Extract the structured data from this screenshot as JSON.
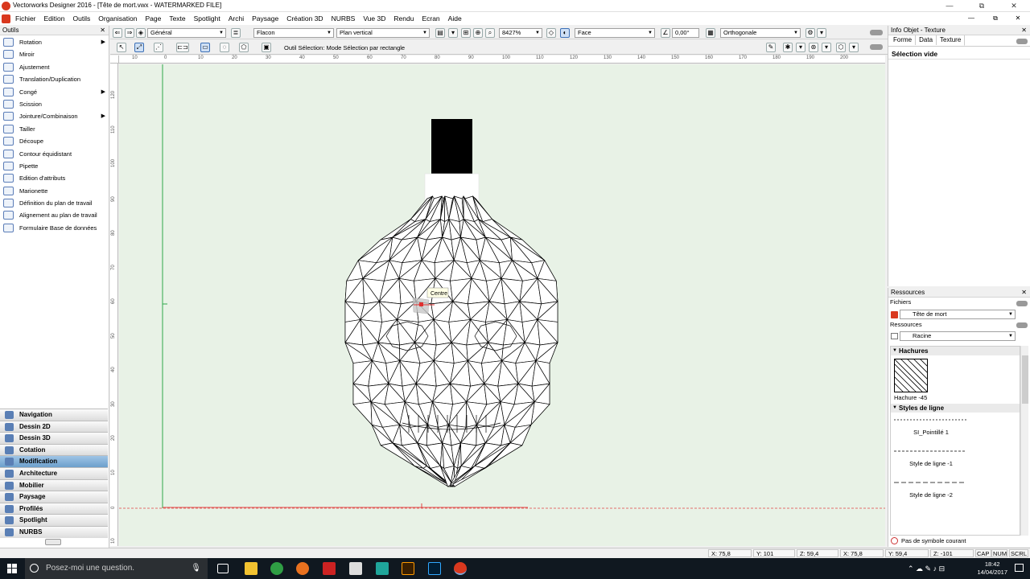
{
  "window": {
    "title": "Vectorworks Designer 2016 - [Tête de mort.vwx - WATERMARKED FILE]",
    "controls": [
      "—",
      "⧉",
      "✕"
    ],
    "doc_controls": [
      "—",
      "⧉",
      "✕"
    ]
  },
  "menu": [
    "Fichier",
    "Edition",
    "Outils",
    "Organisation",
    "Page",
    "Texte",
    "Spotlight",
    "Archi",
    "Paysage",
    "Création 3D",
    "NURBS",
    "Vue 3D",
    "Rendu",
    "Ecran",
    "Aide"
  ],
  "tools": {
    "title": "Outils",
    "items": [
      {
        "label": "Rotation",
        "arrow": true
      },
      {
        "label": "Miroir",
        "arrow": false
      },
      {
        "label": "Ajustement",
        "arrow": false
      },
      {
        "label": "Translation/Duplication",
        "arrow": false
      },
      {
        "label": "Congé",
        "arrow": true
      },
      {
        "label": "Scission",
        "arrow": false
      },
      {
        "label": "Jointure/Combinaison",
        "arrow": true
      },
      {
        "label": "Tailler",
        "arrow": false
      },
      {
        "label": "Découpe",
        "arrow": false
      },
      {
        "label": "Contour équidistant",
        "arrow": false
      },
      {
        "label": "Pipette",
        "arrow": false
      },
      {
        "label": "Edition d'attributs",
        "arrow": false
      },
      {
        "label": "Marionette",
        "arrow": false
      },
      {
        "label": "Définition du plan de travail",
        "arrow": false
      },
      {
        "label": "Alignement au plan de travail",
        "arrow": false
      },
      {
        "label": "Formulaire Base de données",
        "arrow": false
      }
    ],
    "palettes": [
      "Navigation",
      "Dessin 2D",
      "Dessin 3D",
      "Cotation",
      "Modification",
      "Architecture",
      "Mobilier",
      "Paysage",
      "Profilés",
      "Spotlight",
      "NURBS"
    ],
    "selected_palette": "Modification"
  },
  "toolbar": {
    "class_value": "Général",
    "layer_value": "Flacon",
    "plane_value": "Plan vertical",
    "zoom_value": "8427%",
    "view_value": "Face",
    "angle_value": "0,00°",
    "projection_value": "Orthogonale",
    "mode_text": "Outil Sélection: Mode Sélection par rectangle"
  },
  "rulers": {
    "h": [
      "10",
      "0",
      "10",
      "20",
      "30",
      "40",
      "50",
      "60",
      "70",
      "80",
      "90",
      "100",
      "110",
      "120",
      "130",
      "140",
      "150",
      "160",
      "170",
      "180",
      "190",
      "200"
    ],
    "v": [
      "120",
      "110",
      "100",
      "90",
      "80",
      "70",
      "60",
      "50",
      "40",
      "30",
      "20",
      "10",
      "0",
      "10"
    ]
  },
  "canvas": {
    "snap_tooltip": "Centre"
  },
  "obj_info": {
    "title": "Info Objet - Texture",
    "tabs": [
      "Forme",
      "Data",
      "Texture"
    ],
    "active_tab": "Texture",
    "status": "Sélection vide"
  },
  "resources": {
    "title": "Ressources",
    "files_label": "Fichiers",
    "files_value": "Tête de mort",
    "res_label": "Ressources",
    "res_value": "Racine",
    "hatch_section": "Hachures",
    "hatch_name": "Hachure -45",
    "line_section": "Styles de ligne",
    "line_styles": [
      "SI_Pointillé 1",
      "Style de ligne -1",
      "Style de ligne -2"
    ],
    "footer": "Pas de symbole courant"
  },
  "status": {
    "coords": [
      "X: 75,8",
      "Y: 101",
      "Z: 59,4",
      "X: 75,8",
      "Y: 59,4",
      "Z: -101"
    ],
    "keys": [
      "CAP",
      "NUM",
      "SCRL"
    ]
  },
  "taskbar": {
    "search_placeholder": "Posez-moi une question.",
    "time": "18:42",
    "date": "14/04/2017"
  },
  "colors": {
    "canvas_bg": "#e8f2e6",
    "accent": "#6c9fcb",
    "taskbar": "#101820"
  }
}
